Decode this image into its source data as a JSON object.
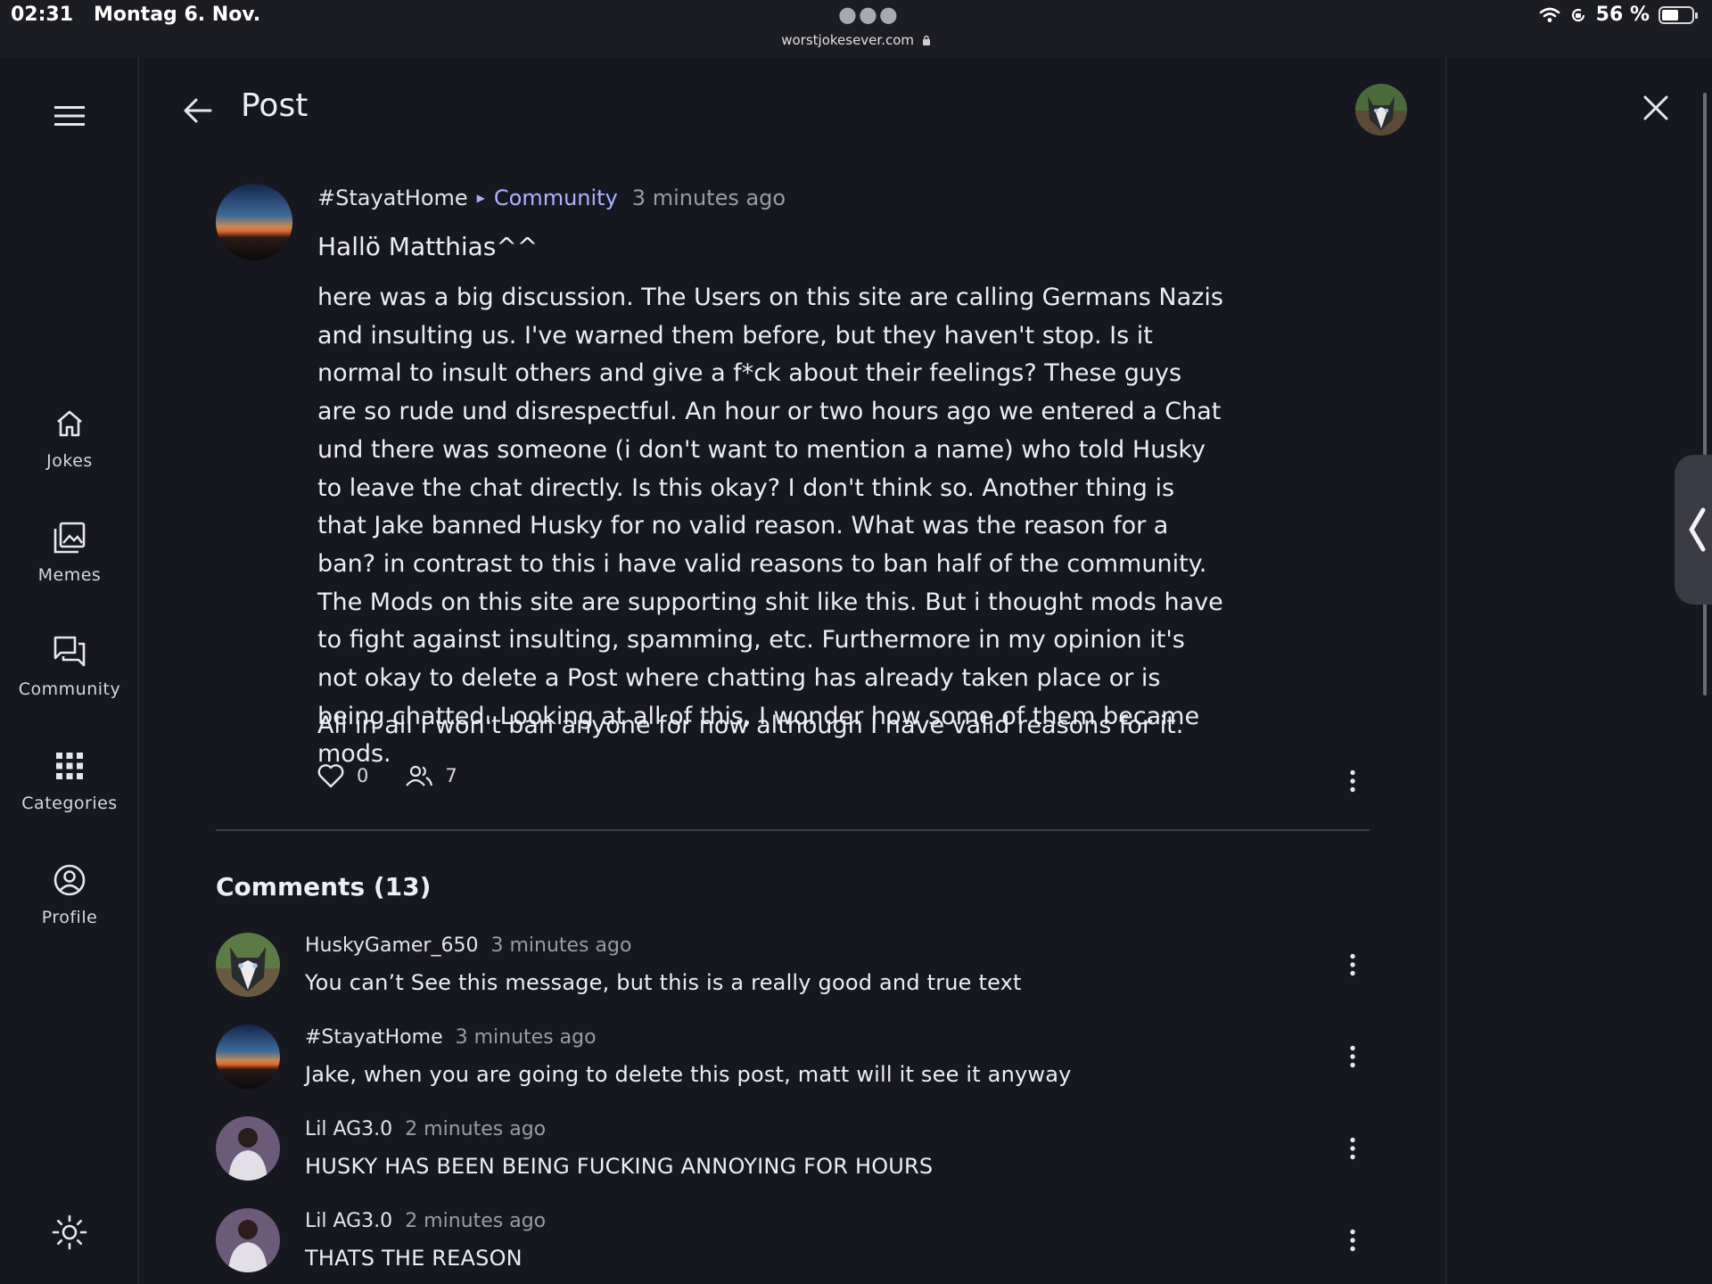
{
  "status_bar": {
    "time": "02:31",
    "date": "Montag 6. Nov.",
    "url": "worstjokesever.com",
    "battery": "56 %"
  },
  "sidebar": {
    "items": [
      {
        "label": "Jokes",
        "icon": "home-icon"
      },
      {
        "label": "Memes",
        "icon": "gallery-icon"
      },
      {
        "label": "Community",
        "icon": "chat-icon"
      },
      {
        "label": "Categories",
        "icon": "grid-icon"
      },
      {
        "label": "Profile",
        "icon": "user-circle-icon"
      }
    ]
  },
  "header": {
    "title": "Post"
  },
  "post": {
    "author": "#StayatHome",
    "community": "Community",
    "time": "3 minutes ago",
    "greeting": "Hallö Matthias^^",
    "body": "here was a big discussion. The Users on this site are calling Germans Nazis and insulting us. I've warned them before, but they haven't stop. Is it normal to insult others and give a f*ck about their feelings? These guys are so rude und disrespectful. An hour or two hours ago we entered a Chat und there was someone (i don't want to mention a name) who told Husky to leave the chat directly. Is this okay? I don't think so. Another thing is that Jake banned Husky for no valid reason. What was the reason for a ban? in contrast to this i have valid reasons to ban half of the community. The Mods on this site are supporting shit like this. But i thought mods have to fight against insulting, spamming, etc. Furthermore in my opinion it's not okay to delete a Post where chatting has already taken place or is being chatted. Looking at all of this, I wonder how some of them became mods.",
    "closing": "All in all I won't ban anyone for now although I have valid reasons for it.",
    "likes": "0",
    "participants": "7"
  },
  "comments": {
    "title": "Comments (13)",
    "items": [
      {
        "author": "HuskyGamer_650",
        "time": "3 minutes ago",
        "text": "You can’t See this message, but this is a really good and true text",
        "avatar": "husky"
      },
      {
        "author": "#StayatHome",
        "time": "3 minutes ago",
        "text": "Jake, when you are going to delete this post, matt will it see it anyway",
        "avatar": "sunset"
      },
      {
        "author": "Lil AG3.0",
        "time": "2 minutes ago",
        "text": "HUSKY HAS BEEN BEING FUCKING ANNOYING FOR HOURS",
        "avatar": "person"
      },
      {
        "author": "Lil AG3.0",
        "time": "2 minutes ago",
        "text": "THATS THE REASON",
        "avatar": "person"
      }
    ]
  }
}
